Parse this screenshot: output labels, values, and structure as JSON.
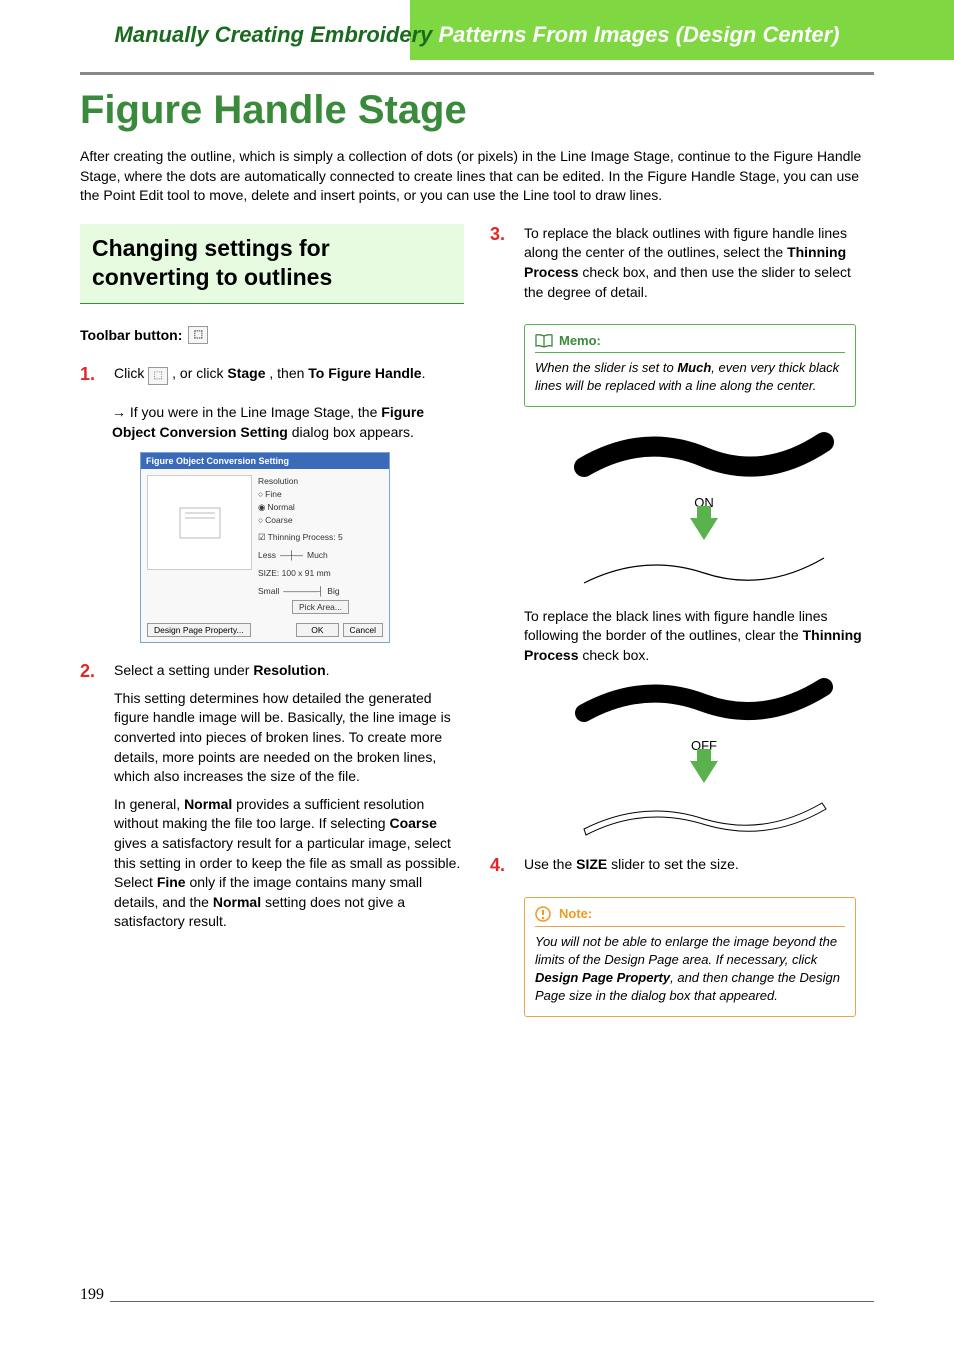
{
  "header": {
    "title_full": "Manually Creating Embroidery Patterns From Images (Design Center)"
  },
  "main": {
    "title": "Figure Handle Stage",
    "intro": "After creating the outline, which is simply a collection of dots (or pixels) in the Line Image Stage, continue to the Figure Handle Stage, where the dots are automatically connected to create lines that can be edited. In the Figure Handle Stage, you can use the Point Edit tool to move, delete and insert points, or you can use the Line tool to draw lines."
  },
  "subheading": "Changing settings for converting to outlines",
  "toolbar_label": "Toolbar button:",
  "steps": {
    "s1": {
      "num": "1.",
      "pre": "Click ",
      "mid": " , or click ",
      "stage": "Stage",
      "then": ", then ",
      "to_fig": "To Figure Handle",
      "post": ".",
      "arrow_pre": "→ If you were in the Line Image Stage, the ",
      "arrow_bold": "Figure Object Conversion Setting",
      "arrow_post": " dialog box appears."
    },
    "s2": {
      "num": "2.",
      "line1_pre": "Select a setting under ",
      "line1_bold": "Resolution",
      "line1_post": ".",
      "para1": "This setting determines how detailed the generated figure handle image will be. Basically, the line image is converted into pieces of broken lines. To create more details, more points are needed on the broken lines, which also increases the size of the file.",
      "para2_pre": "In general, ",
      "para2_b1": "Normal",
      "para2_mid": " provides a sufficient resolution without making the file too large. If selecting ",
      "para2_b2": "Coarse",
      "para2_mid2": " gives a satisfactory result for a particular image, select this setting in order to keep the file as small as possible. Select ",
      "para2_b3": "Fine",
      "para2_mid3": " only if the image contains many small details, and the ",
      "para2_b4": "Normal",
      "para2_post": " setting does not give a satisfactory result."
    },
    "s3": {
      "num": "3.",
      "p1_pre": "To replace the black outlines with figure handle lines along the center of the outlines, select the ",
      "p1_b": "Thinning Process",
      "p1_post": " check box, and then use the slider to select the degree of detail.",
      "p2_pre": "To replace the black lines with figure handle lines following the border of the outlines, clear the ",
      "p2_b": "Thinning Process",
      "p2_post": " check box."
    },
    "s4": {
      "num": "4.",
      "pre": "Use the ",
      "b": "SIZE",
      "post": " slider to set the size."
    }
  },
  "memo": {
    "title": "Memo:",
    "body_pre": "When the slider is set to ",
    "body_bold": "Much",
    "body_post": ", even very thick black lines will be replaced with a line along the center."
  },
  "note": {
    "title": "Note:",
    "body_pre": "You will not be able to enlarge the image beyond the limits of the Design Page area. If necessary, click ",
    "body_bold": "Design Page Property",
    "body_post": ", and then change the Design Page size in the dialog box that appeared."
  },
  "diagram": {
    "on": "ON",
    "off": "OFF"
  },
  "dialog": {
    "title": "Figure Object Conversion Setting",
    "resolution": "Resolution",
    "fine": "Fine",
    "normal": "Normal",
    "coarse": "Coarse",
    "thinning": "Thinning Process: 5",
    "less": "Less",
    "much": "Much",
    "size": "SIZE:  100 x  91 mm",
    "small": "Small",
    "big": "Big",
    "pick": "Pick Area...",
    "dpp": "Design Page Property...",
    "ok": "OK",
    "cancel": "Cancel"
  },
  "page_number": "199"
}
